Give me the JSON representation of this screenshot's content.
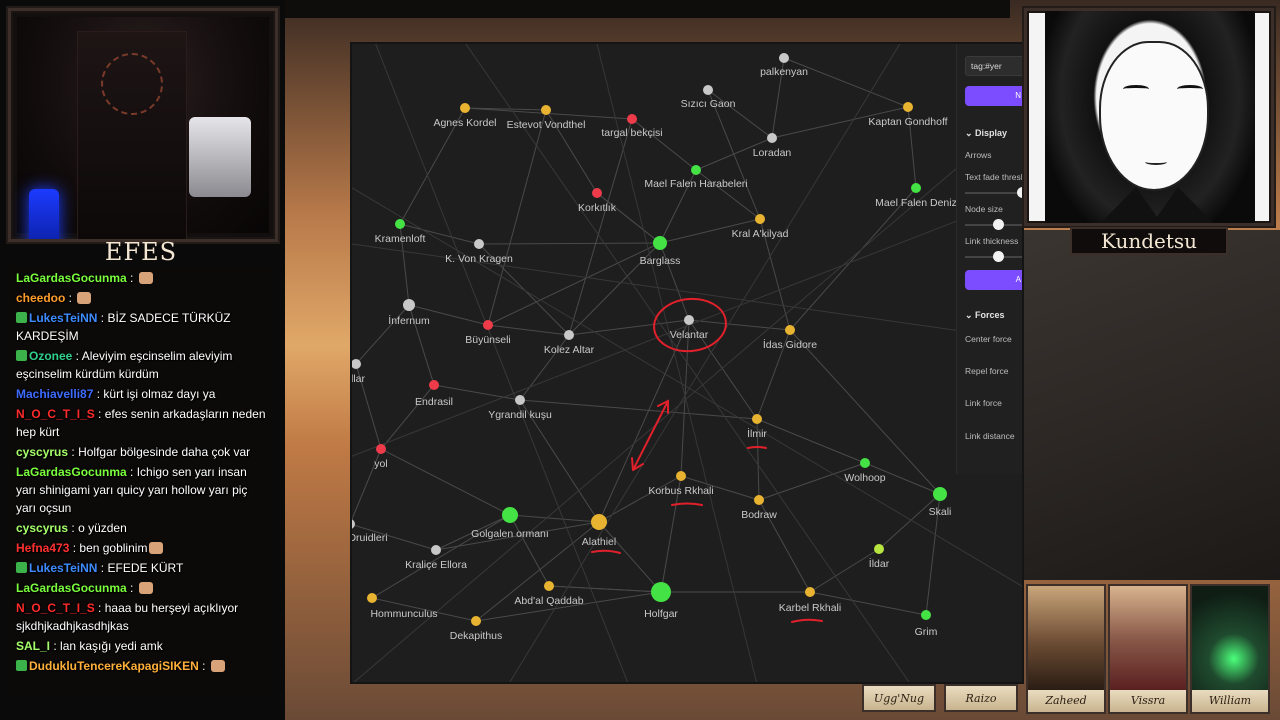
{
  "streamer": {
    "name": "EFES"
  },
  "chat": {
    "messages": [
      {
        "user": "LaGardasGocunma",
        "color": "#7bff3d",
        "text": "",
        "emote": true
      },
      {
        "user": "cheedoo",
        "color": "#ff9d2a",
        "text": "",
        "emote": true
      },
      {
        "user": "LukesTeiNN",
        "color": "#3d8bff",
        "text": "BİZ SADECE TÜRKÜZ KARDEŞİM",
        "badge": true
      },
      {
        "user": "Ozonee",
        "color": "#31d08c",
        "text": "Aleviyim eşcinselim aleviyim eşcinselim kürdüm kürdüm",
        "badge": true
      },
      {
        "user": "Machiavelli87",
        "color": "#3d6bff",
        "text": "kürt işi olmaz dayı ya"
      },
      {
        "user": "N_O_C_T_I_S",
        "color": "#ff2a2a",
        "text": "efes senin arkadaşların neden hep kürt"
      },
      {
        "user": "cyscyrus",
        "color": "#a6ff6a",
        "text": "Holfgar bölgesinde daha çok var"
      },
      {
        "user": "LaGardasGocunma",
        "color": "#7bff3d",
        "text": "Ichigo sen yarı insan yarı shinigami yarı quicy yarı hollow yarı piç yarı oçsun"
      },
      {
        "user": "cyscyrus",
        "color": "#a6ff6a",
        "text": "o yüzden"
      },
      {
        "user": "Hefna473",
        "color": "#ff3030",
        "text": "ben goblinim",
        "emote": true
      },
      {
        "user": "LukesTeiNN",
        "color": "#3d8bff",
        "text": "EFEDE KÜRT",
        "badge": true
      },
      {
        "user": "LaGardasGocunma",
        "color": "#7bff3d",
        "text": "",
        "emote": true
      },
      {
        "user": "N_O_C_T_I_S",
        "color": "#ff2a2a",
        "text": "haaa bu herşeyi açıklıyor sjkdhjkadhjkasdhjkas"
      },
      {
        "user": "SAL_I",
        "color": "#a6ff6a",
        "text": "lan kaşığı yedi amk"
      },
      {
        "user": "DudukluTencereKapagiSIKEN",
        "color": "#ffb03a",
        "text": "",
        "badge": true,
        "emote": true
      }
    ]
  },
  "graph": {
    "nodes": [
      {
        "label": "palkenyan",
        "color": "#c8c8c8"
      },
      {
        "label": "Sızıcı Gaon",
        "color": "#c8c8c8"
      },
      {
        "label": "Agnes Kordel",
        "color": "#e8b330"
      },
      {
        "label": "Estevot Vondthel",
        "color": "#e8b330"
      },
      {
        "label": "targal bekçisi",
        "color": "#ee3b4a"
      },
      {
        "label": "Kaptan Gondhoff",
        "color": "#e8b330"
      },
      {
        "label": "Loradan",
        "color": "#c8c8c8"
      },
      {
        "label": "Mael Falen Harabeleri",
        "color": "#44e244"
      },
      {
        "label": "Korkıtlık",
        "color": "#ee3b4a"
      },
      {
        "label": "Mael Falen Deniz",
        "color": "#44e244"
      },
      {
        "label": "Kral A'kilyad",
        "color": "#e8b330"
      },
      {
        "label": "Kramenloft",
        "color": "#44e244"
      },
      {
        "label": "K. Von Kragen",
        "color": "#c8c8c8"
      },
      {
        "label": "Barglass",
        "color": "#44e244"
      },
      {
        "label": "İnfernum",
        "color": "#c8c8c8"
      },
      {
        "label": "Büyünseli",
        "color": "#ee3b4a"
      },
      {
        "label": "Kolez Altar",
        "color": "#c8c8c8"
      },
      {
        "label": "Velantar",
        "color": "#c8c8c8"
      },
      {
        "label": "İdas Gidore",
        "color": "#e8b330"
      },
      {
        "label": "llar",
        "color": "#c8c8c8"
      },
      {
        "label": "Endrasil",
        "color": "#ee3b4a"
      },
      {
        "label": "Ygrandil kuşu",
        "color": "#c8c8c8"
      },
      {
        "label": "İlmir",
        "color": "#e8b330"
      },
      {
        "label": "yol",
        "color": "#ee3b4a"
      },
      {
        "label": "Wolhoop",
        "color": "#44e244"
      },
      {
        "label": "Korbus Rkhali",
        "color": "#e8b330"
      },
      {
        "label": "Bodraw",
        "color": "#e8b330"
      },
      {
        "label": "Skali",
        "color": "#44e244"
      },
      {
        "label": "Golgalen ormanı",
        "color": "#44e244"
      },
      {
        "label": "Alathiel",
        "color": "#e8b330"
      },
      {
        "label": "Druidleri",
        "color": "#c8c8c8"
      },
      {
        "label": "Kraliçe Ellora",
        "color": "#c8c8c8"
      },
      {
        "label": "İldar",
        "color": "#b8e640"
      },
      {
        "label": "Abd'al Qaddab",
        "color": "#e8b330"
      },
      {
        "label": "Hommunculus",
        "color": "#e8b330"
      },
      {
        "label": "Holfgar",
        "color": "#44e244"
      },
      {
        "label": "Karbel Rkhali",
        "color": "#e8b330"
      },
      {
        "label": "Dekapithus",
        "color": "#e8b330"
      },
      {
        "label": "Grim",
        "color": "#44e244"
      }
    ],
    "settings": {
      "search": "tag:#yer",
      "button1": "N",
      "display_header": "Display",
      "arrows": "Arrows",
      "text_fade": "Text fade thresh",
      "node_size": "Node size",
      "link_thickness": "Link thickness",
      "button2": "A",
      "forces_header": "Forces",
      "center_force": "Center force",
      "repel_force": "Repel force",
      "link_force": "Link force",
      "link_distance": "Link distance",
      "accent": "#7b4dff"
    }
  },
  "character": {
    "name": "Kundetsu"
  },
  "party": {
    "small": [
      "Ugg'Nug",
      "Raizo"
    ],
    "cards": [
      {
        "name": "Zaheed",
        "tone": "#6b4b33"
      },
      {
        "name": "Vissra",
        "tone": "#8a5a4a"
      },
      {
        "name": "William",
        "tone": "#1f4a2e"
      }
    ]
  }
}
